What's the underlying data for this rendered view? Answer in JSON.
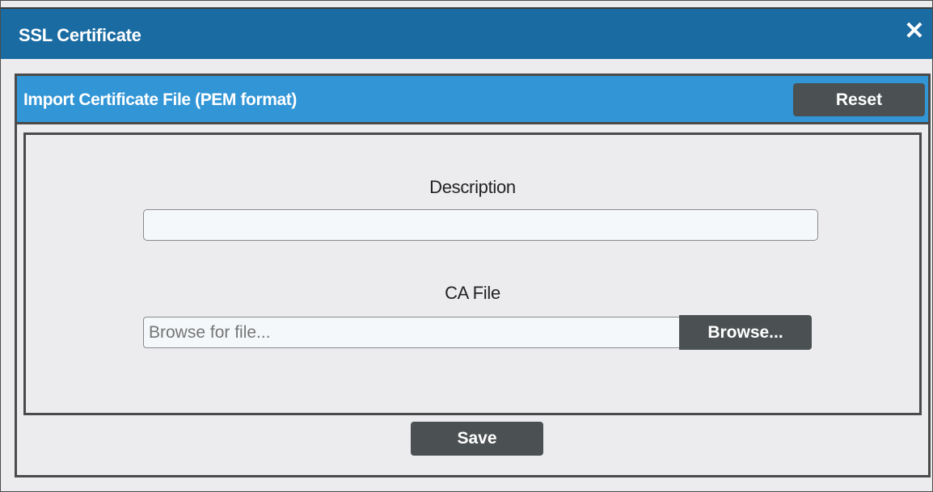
{
  "dialog": {
    "title": "SSL Certificate",
    "close_icon": "close-icon"
  },
  "panel": {
    "title": "Import Certificate File (PEM format)",
    "reset_label": "Reset"
  },
  "form": {
    "description_label": "Description",
    "description_value": "",
    "ca_file_label": "CA File",
    "ca_file_placeholder": "Browse for file...",
    "browse_label": "Browse...",
    "save_label": "Save"
  },
  "colors": {
    "titlebar": "#1a6ba2",
    "panel_header": "#3296d6",
    "button": "#4b5152",
    "background": "#ececef"
  }
}
